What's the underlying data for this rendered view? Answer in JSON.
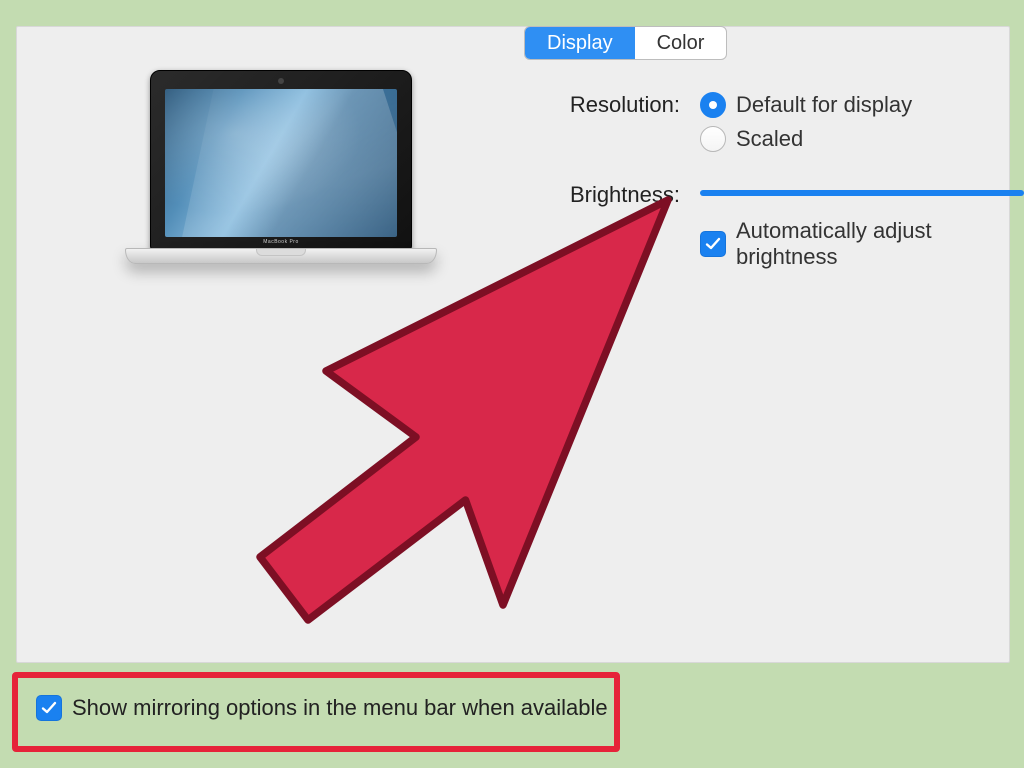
{
  "tabs": {
    "display": "Display",
    "color": "Color"
  },
  "labels": {
    "resolution": "Resolution:",
    "brightness": "Brightness:"
  },
  "resolution": {
    "default": "Default for display",
    "scaled": "Scaled"
  },
  "auto_brightness": "Automatically adjust brightness",
  "mirroring": "Show mirroring options in the menu bar when available",
  "laptop_model": "MacBook Pro",
  "colors": {
    "accent": "#1a81f0",
    "highlight": "#e62339",
    "background": "#c3dcb1"
  }
}
